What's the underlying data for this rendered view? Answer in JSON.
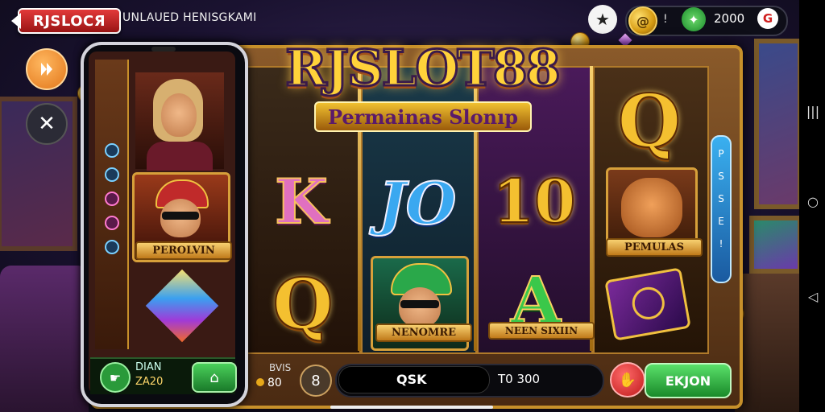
{
  "header": {
    "logo_text": "RJSLOCЯ",
    "title": "UNLAUED HENISGKAMI"
  },
  "hud": {
    "star_icon": "star-icon",
    "coin_glyph": "@",
    "separator": "!",
    "gem_glyph": "✦",
    "amount": "2000",
    "g_glyph": "G"
  },
  "side": {
    "orange_icon": "media-play-icon",
    "close_glyph": "✕"
  },
  "banner": {
    "title": "RJSLOT88",
    "subtitle": "Permainas Slonıp"
  },
  "reels": {
    "symbols": {
      "r1_top": "K",
      "r1_bottom": "Q",
      "r2_mid": "JO",
      "r3_mid": "10",
      "r3_bottom": "A",
      "r4_top": "Q"
    },
    "plaques": {
      "phone_char": "PEROLVIN",
      "reel2_char": "NENOMRE",
      "reel3_char": "NEEN SIXIIN",
      "reel4_char": "PEMULAS"
    }
  },
  "side_column": {
    "labels": [
      "P",
      "S",
      "S",
      "E",
      "!"
    ]
  },
  "phone": {
    "label_top": "DIAN",
    "label_bottom": "ZA20"
  },
  "controls": {
    "bet_label": "BVIS",
    "bet_value": "80",
    "spin_glyph": "8",
    "middle_label": "QSK",
    "right_label": "T0 300",
    "action_label": "EKJON"
  },
  "colors": {
    "accent_gold": "#f4c030",
    "frame_gold": "#d7a03a",
    "green_button": "#2aa82a",
    "red_button": "#c01a1a",
    "logo_red": "#e23a3a"
  }
}
